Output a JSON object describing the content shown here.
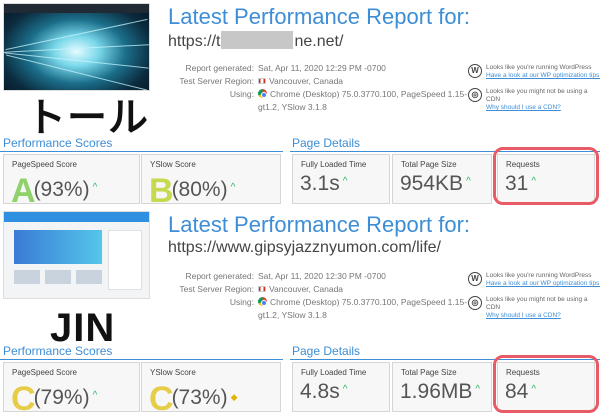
{
  "reports": [
    {
      "caption": "トール",
      "title": "Latest Performance Report for:",
      "url_prefix": "https://t",
      "url_suffix": "ne.net/",
      "meta": {
        "report_generated_label": "Report generated:",
        "report_generated": "Sat, Apr 11, 2020 12:29 PM -0700",
        "server_label": "Test Server Region:",
        "server": "Vancouver, Canada",
        "using_label": "Using:",
        "using": "Chrome (Desktop) 75.0.3770.100, PageSpeed 1.15-gt1.2, YSlow 3.1.8"
      },
      "tips": [
        {
          "text": "Looks like you're running WordPress",
          "link": "Have a look at our WP optimization tips »",
          "icon": "wordpress-icon"
        },
        {
          "text": "Looks like you might not be using a CDN",
          "link": "Why should I use a CDN?",
          "icon": "cdn-globe-icon"
        }
      ],
      "performance_title": "Performance Scores",
      "page_details_title": "Page Details",
      "scores": [
        {
          "label": "PageSpeed Score",
          "grade": "A",
          "value": "(93%)",
          "trend": "up"
        },
        {
          "label": "YSlow Score",
          "grade": "B",
          "value": "(80%)",
          "trend": "up"
        }
      ],
      "details": [
        {
          "label": "Fully Loaded Time",
          "value": "3.1s",
          "trend": "up"
        },
        {
          "label": "Total Page Size",
          "value": "954KB",
          "trend": "up"
        },
        {
          "label": "Requests",
          "value": "31",
          "trend": "up"
        }
      ],
      "arrow_up": "^",
      "arrow_warn": "◆"
    },
    {
      "caption": "JIN",
      "title": "Latest Performance Report for:",
      "url_prefix": "https://www.gipsyjazznyumon.com/life/",
      "url_suffix": "",
      "meta": {
        "report_generated_label": "Report generated:",
        "report_generated": "Sat, Apr 11, 2020 12:30 PM -0700",
        "server_label": "Test Server Region:",
        "server": "Vancouver, Canada",
        "using_label": "Using:",
        "using": "Chrome (Desktop) 75.0.3770.100, PageSpeed 1.15-gt1.2, YSlow 3.1.8"
      },
      "tips": [
        {
          "text": "Looks like you're running WordPress",
          "link": "Have a look at our WP optimization tips »",
          "icon": "wordpress-icon"
        },
        {
          "text": "Looks like you might not be using a CDN",
          "link": "Why should I use a CDN?",
          "icon": "cdn-globe-icon"
        }
      ],
      "performance_title": "Performance Scores",
      "page_details_title": "Page Details",
      "scores": [
        {
          "label": "PageSpeed Score",
          "grade": "C",
          "value": "(79%)",
          "trend": "up"
        },
        {
          "label": "YSlow Score",
          "grade": "C",
          "value": "(73%)",
          "trend": "flat"
        }
      ],
      "details": [
        {
          "label": "Fully Loaded Time",
          "value": "4.8s",
          "trend": "up"
        },
        {
          "label": "Total Page Size",
          "value": "1.96MB",
          "trend": "up"
        },
        {
          "label": "Requests",
          "value": "84",
          "trend": "up"
        }
      ],
      "arrow_up": "^",
      "arrow_warn": "◆"
    }
  ],
  "colors": {
    "accent": "#3d8ed6",
    "grade_a": "#8fd16a",
    "grade_b": "#c6d94f",
    "grade_c": "#e6cd48",
    "trend_up": "#2fb561",
    "highlight": "#e85a66"
  }
}
